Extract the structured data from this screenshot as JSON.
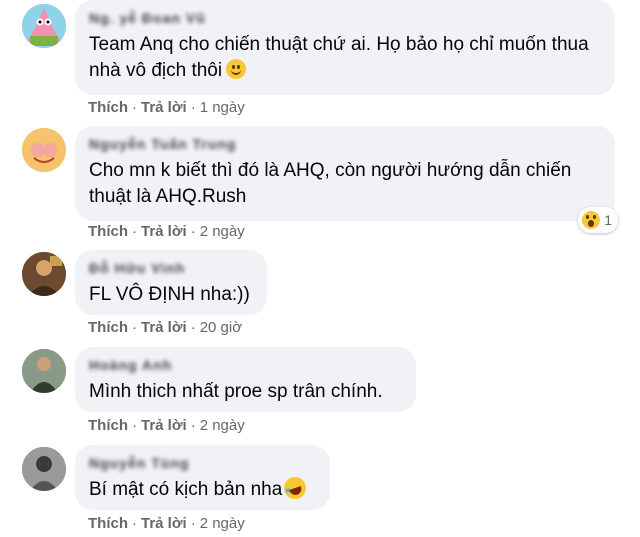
{
  "actions": {
    "like_label": "Thích",
    "reply_label": "Trả lời",
    "separator": "·"
  },
  "comments": [
    {
      "author": "Ng. yễ   Đoan  Vũ",
      "text": "Team Anq cho chiến thuật chứ ai. Họ bảo họ chỉ muốn thua nhà vô địch thôi",
      "text_emoji": "smiling-face",
      "time": "1 ngày"
    },
    {
      "author": "Nguyễn Tuấn Trung",
      "text": "Cho mn k biết thì đó là AHQ, còn người hướng dẫn chiến thuật là AHQ.Rush",
      "time": "2 ngày",
      "reaction": {
        "icon": "wow-reaction",
        "count": "1"
      }
    },
    {
      "author": "Đỗ Hữu Vinh",
      "text": "FL VÔ ĐỊNH nha:))",
      "time": "20 giờ"
    },
    {
      "author": "Hoàng Anh",
      "text": "Mình thich nhất proe sp trân chính.",
      "time": "2 ngày"
    },
    {
      "author": "Nguyễn Tùng",
      "text": "Bí mật có kịch bản nha",
      "text_emoji": "rolling-on-floor-laughing",
      "time": "2 ngày"
    }
  ]
}
